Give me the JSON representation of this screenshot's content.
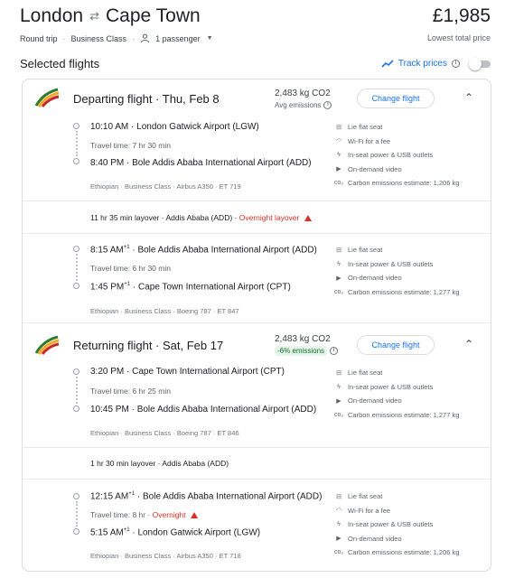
{
  "header": {
    "origin": "London",
    "destination": "Cape Town",
    "price": "£1,985",
    "price_note": "Lowest total price",
    "trip_type": "Round trip",
    "cabin_class": "Business Class",
    "passengers": "1 passenger"
  },
  "selected_flights_label": "Selected flights",
  "track_prices_label": "Track prices",
  "track_prices_on": false,
  "change_flight_label": "Change flight",
  "departing": {
    "title": "Departing flight · Thu, Feb 8",
    "co2": "2,483 kg CO2",
    "co2_note": "Avg emissions",
    "legs": [
      {
        "depart_time": "10:10 AM",
        "depart_airport": "London Gatwick Airport (LGW)",
        "travel_time": "Travel time: 7 hr 30 min",
        "arrive_time": "8:40 PM",
        "arrive_airport": "Bole Addis Ababa International Airport (ADD)",
        "details": "Ethiopian · Business Class · Airbus A350 · ET 719",
        "amenities": [
          "Lie flat seat",
          "Wi-Fi for a fee",
          "In-seat power & USB outlets",
          "On-demand video",
          "Carbon emissions estimate: 1,206 kg"
        ]
      },
      {
        "depart_time": "8:15 AM",
        "depart_plus": "+1",
        "depart_airport": "Bole Addis Ababa International Airport (ADD)",
        "travel_time": "Travel time: 6 hr 30 min",
        "arrive_time": "1:45 PM",
        "arrive_plus": "+1",
        "arrive_airport": "Cape Town International Airport (CPT)",
        "details": "Ethiopian · Business Class · Boeing 787 · ET 847",
        "amenities": [
          "Lie flat seat",
          "In-seat power & USB outlets",
          "On-demand video",
          "Carbon emissions estimate: 1,277 kg"
        ]
      }
    ],
    "layover": "11 hr 35 min layover · Addis Ababa (ADD) ·",
    "layover_warning": "Overnight layover"
  },
  "returning": {
    "title": "Returning flight · Sat, Feb 17",
    "co2": "2,483 kg CO2",
    "co2_badge": "-6% emissions",
    "legs": [
      {
        "depart_time": "3:20 PM",
        "depart_airport": "Cape Town International Airport (CPT)",
        "travel_time": "Travel time: 6 hr 25 min",
        "arrive_time": "10:45 PM",
        "arrive_airport": "Bole Addis Ababa International Airport (ADD)",
        "details": "Ethiopian · Business Class · Boeing 787 · ET 846",
        "amenities": [
          "Lie flat seat",
          "In-seat power & USB outlets",
          "On-demand video",
          "Carbon emissions estimate: 1,277 kg"
        ]
      },
      {
        "depart_time": "12:15 AM",
        "depart_plus": "+1",
        "depart_airport": "Bole Addis Ababa International Airport (ADD)",
        "travel_time": "Travel time: 8 hr ·",
        "travel_warning": "Overnight",
        "arrive_time": "5:15 AM",
        "arrive_plus": "+1",
        "arrive_airport": "London Gatwick Airport (LGW)",
        "details": "Ethiopian · Business Class · Airbus A350 · ET 718",
        "amenities": [
          "Lie flat seat",
          "Wi-Fi for a fee",
          "In-seat power & USB outlets",
          "On-demand video",
          "Carbon emissions estimate: 1,206 kg"
        ]
      }
    ],
    "layover": "1 hr 30 min layover · Addis Ababa (ADD)"
  },
  "colors": {
    "accent": "#1a73e8",
    "warning": "#d93025",
    "eco_green": "#137333"
  },
  "icons": [
    "swap-arrows-icon",
    "person-icon",
    "chevron-down-icon",
    "trend-line-icon",
    "info-icon",
    "toggle-switch",
    "ethiopian-logo-icon",
    "chevron-up-icon",
    "seat-icon",
    "wifi-icon",
    "power-plug-icon",
    "video-icon",
    "co2-icon",
    "warning-icon"
  ]
}
